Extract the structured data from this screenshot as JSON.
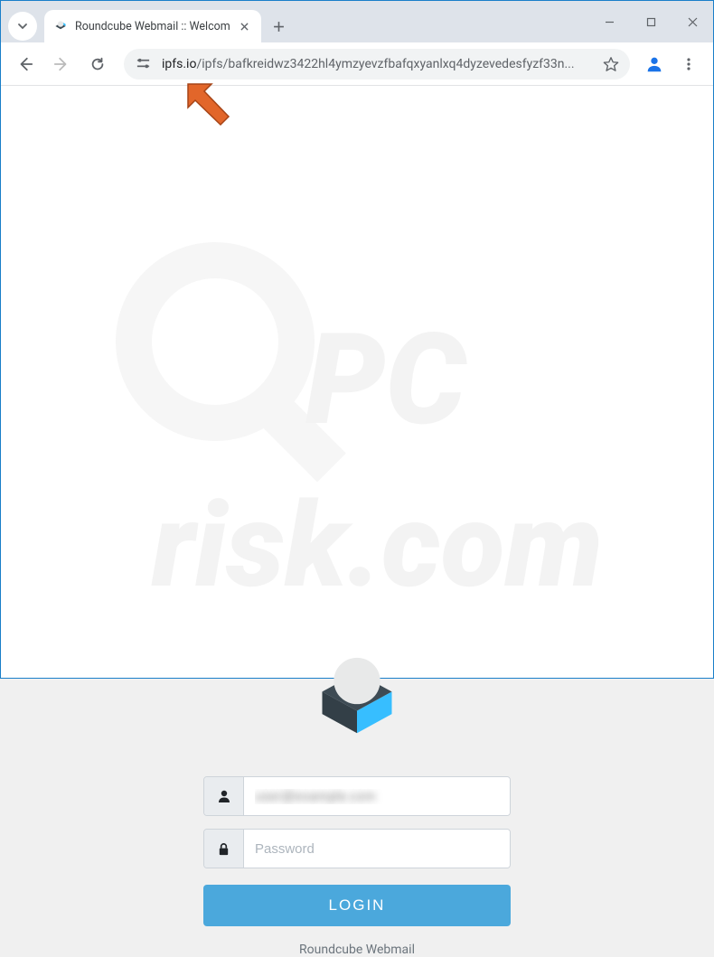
{
  "browser": {
    "tab_title": "Roundcube Webmail :: Welcom",
    "url_domain": "ipfs.io",
    "url_path": "/ipfs/bafkreidwz3422hl4ymzyevzfbafqxyanlxq4dyzevedesfyzf33n..."
  },
  "login": {
    "username_value": "user@example.com",
    "password_placeholder": "Password",
    "button_label": "LOGIN",
    "footer_text": "Roundcube Webmail"
  }
}
